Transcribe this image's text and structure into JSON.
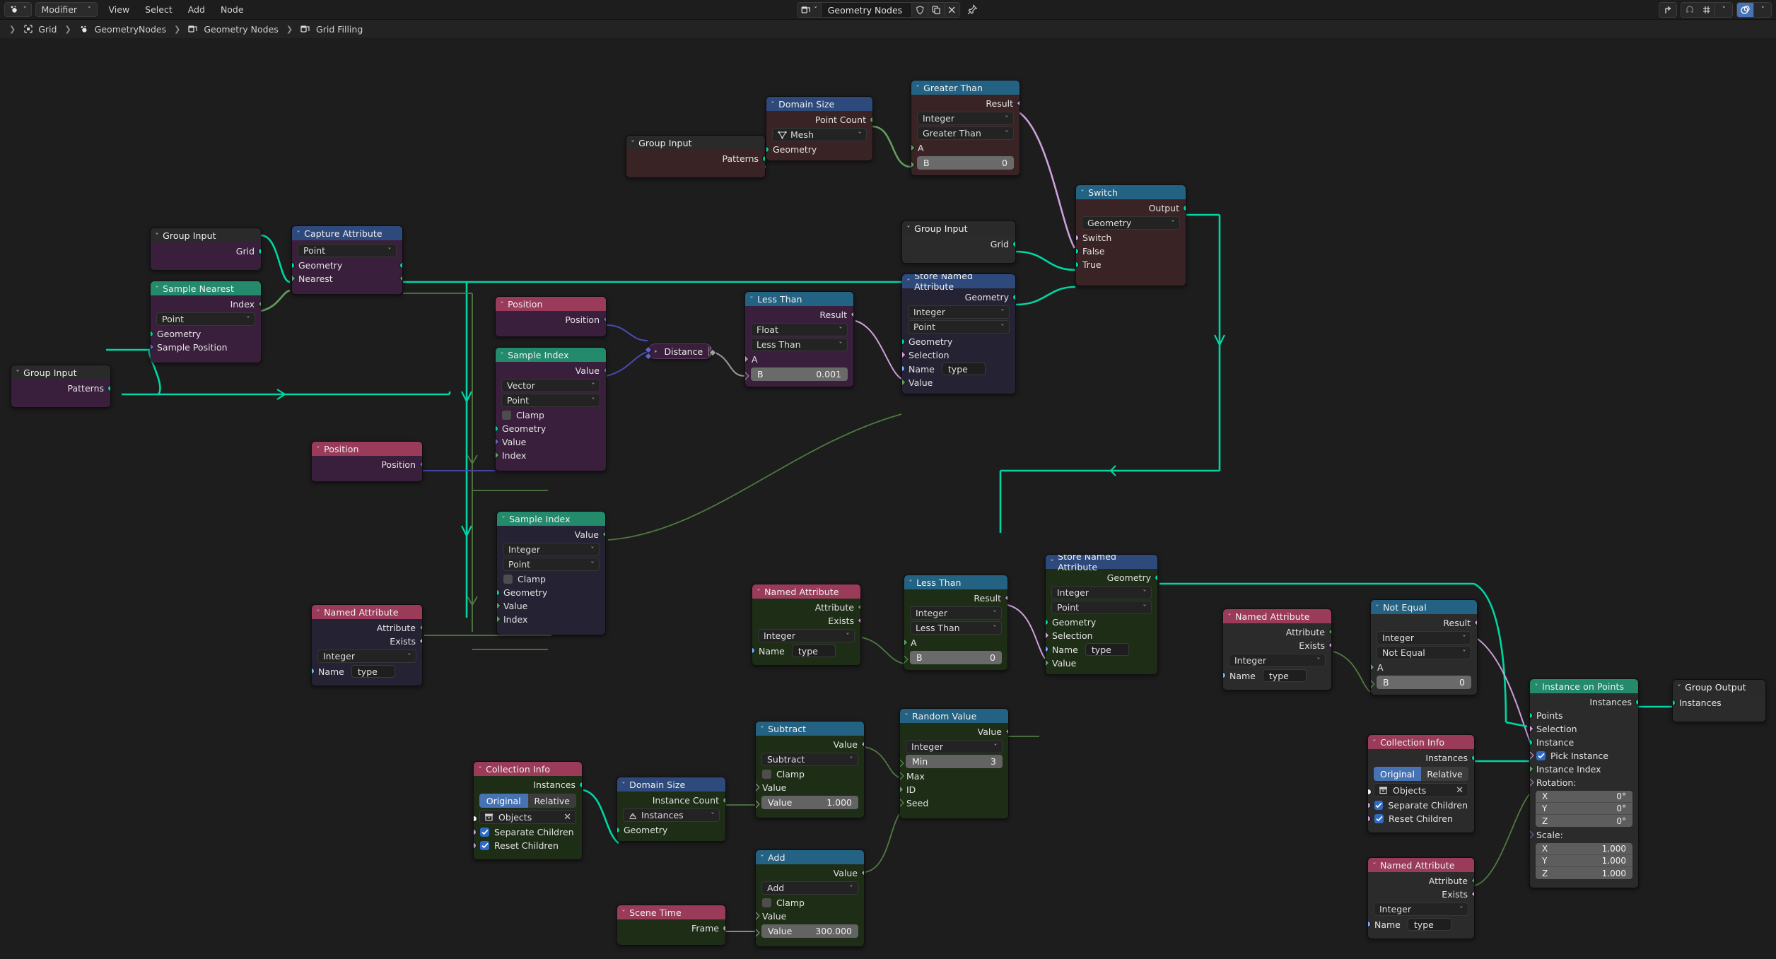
{
  "topbar": {
    "editor_type_icon": "geometry-nodes-editor-icon",
    "mode_selector": "Modifier",
    "menus": [
      "View",
      "Select",
      "Add",
      "Node"
    ],
    "center": {
      "datablock_icon": "node-tree-icon",
      "name": "Geometry Nodes",
      "shield_icon": "fake-user-icon",
      "copy_icon": "new-datablock-icon",
      "close_icon": "unlink-datablock-icon",
      "pin_icon": "pin-icon"
    },
    "right": {
      "snap_parent_icon": "snap-parent-icon",
      "magnet_icon": "snap-magnet-icon",
      "snap_to_icon": "snap-grid-icon",
      "snap_dropdown_icon": "chevron-down-icon",
      "overlay_icon": "overlays-icon",
      "overlay_dropdown_icon": "chevron-down-icon"
    }
  },
  "breadcrumb": [
    {
      "icon": "object-icon",
      "label": "Grid"
    },
    {
      "icon": "modifier-icon",
      "label": "GeometryNodes"
    },
    {
      "icon": "nodetree-icon",
      "label": "Geometry Nodes"
    },
    {
      "icon": "nodetree-icon",
      "label": "Grid Filling"
    }
  ],
  "nodes": {
    "group_input_patterns_top": {
      "title": "Group Input",
      "outputs": [
        "Patterns"
      ]
    },
    "domain_size_top": {
      "title": "Domain Size",
      "outputs": [
        "Point Count"
      ],
      "component": "Mesh",
      "inputs": [
        "Geometry"
      ]
    },
    "greater_than": {
      "title": "Greater Than",
      "outputs": [
        "Result"
      ],
      "data_type": "Integer",
      "operation": "Greater Than",
      "input_a": "A",
      "field_b_label": "B",
      "field_b_value": "0"
    },
    "group_input_grid_mid": {
      "title": "Group Input",
      "outputs": [
        "Grid"
      ]
    },
    "switch": {
      "title": "Switch",
      "outputs": [
        "Output"
      ],
      "data_type": "Geometry",
      "inputs": [
        "Switch",
        "False",
        "True"
      ]
    },
    "store_named_attribute_mid": {
      "title": "Store Named Attribute",
      "outputs": [
        "Geometry"
      ],
      "data_type": "Integer",
      "domain": "Point",
      "inputs": [
        "Geometry",
        "Selection"
      ],
      "name_label": "Name",
      "name_value": "type",
      "value_label": "Value"
    },
    "group_input_grid_left": {
      "title": "Group Input",
      "outputs": [
        "Grid"
      ]
    },
    "capture_attribute": {
      "title": "Capture Attribute",
      "domain": "Point",
      "inputs": [
        "Geometry",
        "Nearest"
      ]
    },
    "sample_nearest": {
      "title": "Sample Nearest",
      "outputs": [
        "Index"
      ],
      "domain": "Point",
      "inputs": [
        "Geometry",
        "Sample Position"
      ]
    },
    "group_input_patterns_left": {
      "title": "Group Input",
      "outputs": [
        "Patterns"
      ]
    },
    "position_top": {
      "title": "Position",
      "outputs": [
        "Position"
      ]
    },
    "sample_index_vector": {
      "title": "Sample Index",
      "outputs": [
        "Value"
      ],
      "data_type": "Vector",
      "domain": "Point",
      "clamp_label": "Clamp",
      "clamp_checked": false,
      "inputs": [
        "Geometry",
        "Value",
        "Index"
      ]
    },
    "distance": {
      "title": "Distance",
      "collapsed": true
    },
    "less_than_float": {
      "title": "Less Than",
      "outputs": [
        "Result"
      ],
      "data_type": "Float",
      "operation": "Less Than",
      "input_a": "A",
      "field_b_label": "B",
      "field_b_value": "0.001"
    },
    "position_mid": {
      "title": "Position",
      "outputs": [
        "Position"
      ]
    },
    "sample_index_integer": {
      "title": "Sample Index",
      "outputs": [
        "Value"
      ],
      "data_type": "Integer",
      "domain": "Point",
      "clamp_label": "Clamp",
      "clamp_checked": false,
      "inputs": [
        "Geometry",
        "Value",
        "Index"
      ]
    },
    "named_attribute_left": {
      "title": "Named Attribute",
      "outputs": [
        "Attribute",
        "Exists"
      ],
      "data_type": "Integer",
      "name_label": "Name",
      "name_value": "type"
    },
    "named_attribute_mid": {
      "title": "Named Attribute",
      "outputs": [
        "Attribute",
        "Exists"
      ],
      "data_type": "Integer",
      "name_label": "Name",
      "name_value": "type"
    },
    "less_than_integer": {
      "title": "Less Than",
      "outputs": [
        "Result"
      ],
      "data_type": "Integer",
      "operation": "Less Than",
      "input_a": "A",
      "field_b_label": "B",
      "field_b_value": "0"
    },
    "store_named_attribute_bottom": {
      "title": "Store Named Attribute",
      "outputs": [
        "Geometry"
      ],
      "data_type": "Integer",
      "domain": "Point",
      "inputs": [
        "Geometry",
        "Selection"
      ],
      "name_label": "Name",
      "name_value": "type",
      "value_label": "Value"
    },
    "named_attribute_right": {
      "title": "Named Attribute",
      "outputs": [
        "Attribute",
        "Exists"
      ],
      "data_type": "Integer",
      "name_label": "Name",
      "name_value": "type"
    },
    "not_equal": {
      "title": "Not Equal",
      "outputs": [
        "Result"
      ],
      "data_type": "Integer",
      "operation": "Not Equal",
      "input_a": "A",
      "field_b_label": "B",
      "field_b_value": "0"
    },
    "instance_on_points": {
      "title": "Instance on Points",
      "outputs": [
        "Instances"
      ],
      "inputs": [
        "Points",
        "Selection",
        "Instance"
      ],
      "pick_instance_label": "Pick Instance",
      "pick_instance_checked": true,
      "instance_index_label": "Instance Index",
      "rotation_label": "Rotation:",
      "rotation": [
        {
          "axis": "X",
          "value": "0°"
        },
        {
          "axis": "Y",
          "value": "0°"
        },
        {
          "axis": "Z",
          "value": "0°"
        }
      ],
      "scale_label": "Scale:",
      "scale": [
        {
          "axis": "X",
          "value": "1.000"
        },
        {
          "axis": "Y",
          "value": "1.000"
        },
        {
          "axis": "Z",
          "value": "1.000"
        }
      ]
    },
    "group_output": {
      "title": "Group Output",
      "inputs": [
        "Instances"
      ]
    },
    "collection_info_right": {
      "title": "Collection Info",
      "outputs": [
        "Instances"
      ],
      "transform_space": [
        "Original",
        "Relative"
      ],
      "transform_space_active": "Original",
      "collection_label": "Objects",
      "separate_children_label": "Separate Children",
      "separate_children_checked": true,
      "reset_children_label": "Reset Children",
      "reset_children_checked": true
    },
    "named_attribute_bottom_right": {
      "title": "Named Attribute",
      "outputs": [
        "Attribute",
        "Exists"
      ],
      "data_type": "Integer",
      "name_label": "Name",
      "name_value": "type"
    },
    "collection_info_bottom": {
      "title": "Collection Info",
      "outputs": [
        "Instances"
      ],
      "transform_space": [
        "Original",
        "Relative"
      ],
      "transform_space_active": "Original",
      "collection_label": "Objects",
      "separate_children_label": "Separate Children",
      "separate_children_checked": true,
      "reset_children_label": "Reset Children",
      "reset_children_checked": true
    },
    "domain_size_bottom": {
      "title": "Domain Size",
      "outputs": [
        "Instance Count"
      ],
      "component": "Instances",
      "inputs": [
        "Geometry"
      ]
    },
    "scene_time": {
      "title": "Scene Time",
      "outputs": [
        "Frame"
      ]
    },
    "subtract": {
      "title": "Subtract",
      "outputs": [
        "Value"
      ],
      "operation": "Subtract",
      "clamp_label": "Clamp",
      "clamp_checked": false,
      "input_value_label": "Value",
      "field_label": "Value",
      "field_value": "1.000"
    },
    "add": {
      "title": "Add",
      "outputs": [
        "Value"
      ],
      "operation": "Add",
      "clamp_label": "Clamp",
      "clamp_checked": false,
      "input_value_label": "Value",
      "field_label": "Value",
      "field_value": "300.000"
    },
    "random_value": {
      "title": "Random Value",
      "outputs": [
        "Value"
      ],
      "data_type": "Integer",
      "min_label": "Min",
      "min_value": "3",
      "inputs": [
        "Max",
        "ID",
        "Seed"
      ]
    }
  },
  "colors": {
    "background": "#1d1d1d",
    "header_geometry": "#2e4a7d",
    "header_attribute": "#238a6b",
    "header_input": "#9a3b5a",
    "header_converter": "#246283",
    "socket_geometry": "#00d6a3",
    "socket_boolean": "#cf9fdc",
    "socket_integer": "#5f9e5f",
    "socket_vector": "#6363c7",
    "socket_float": "#a1a1a1",
    "socket_string": "#70b2ff",
    "accent_blue": "#4772b3",
    "selected_node_body": "#1e2e16"
  }
}
